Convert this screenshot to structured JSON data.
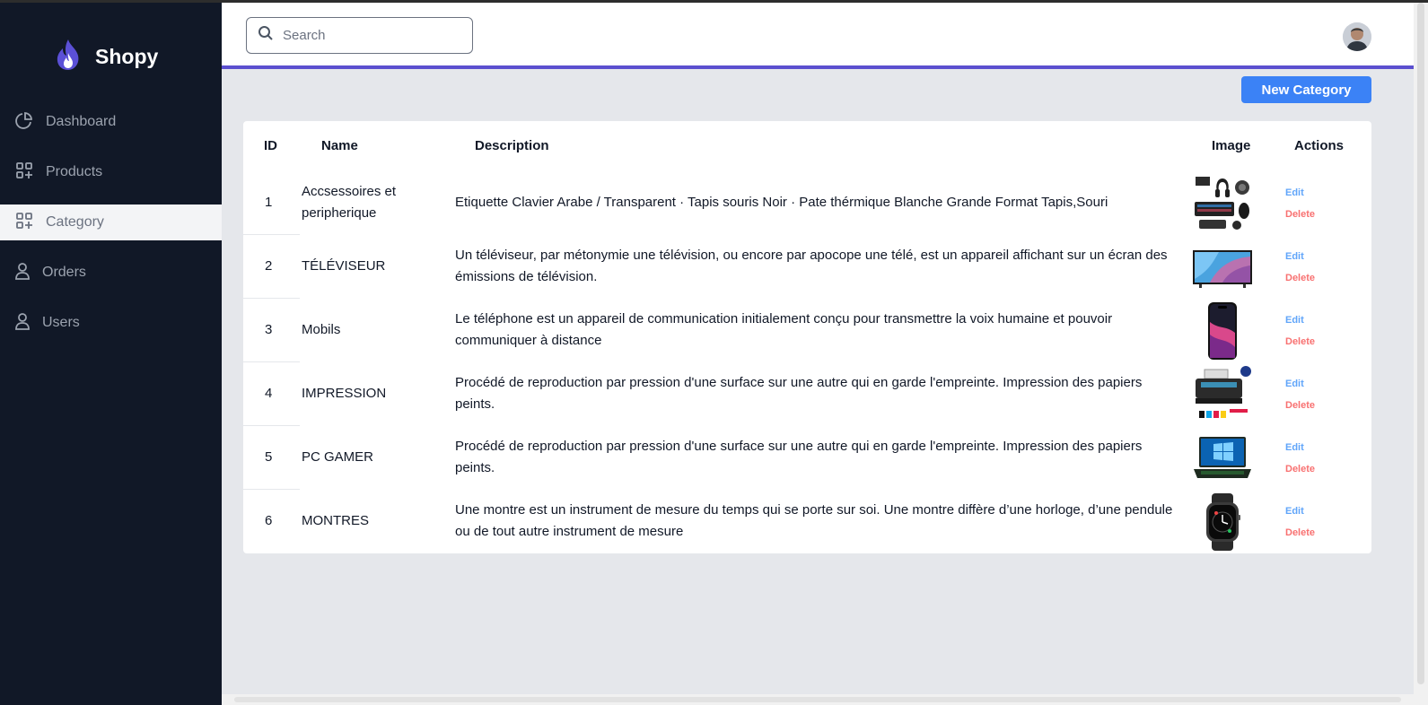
{
  "app": {
    "brand_name": "Shopy",
    "accent_color": "#5b4fcf",
    "button_color": "#3b82f6",
    "sidebar_color": "#111827"
  },
  "sidebar": {
    "items": [
      {
        "label": "Dashboard",
        "icon": "pie-chart-icon",
        "active": false
      },
      {
        "label": "Products",
        "icon": "grid-plus-icon",
        "active": false
      },
      {
        "label": "Category",
        "icon": "grid-plus-icon",
        "active": true
      },
      {
        "label": "Orders",
        "icon": "user-icon",
        "active": false
      },
      {
        "label": "Users",
        "icon": "user-icon",
        "active": false
      }
    ]
  },
  "header": {
    "search_placeholder": "Search",
    "avatar_icon": "user-avatar"
  },
  "toolbar": {
    "new_category_label": "New Category"
  },
  "table": {
    "columns": [
      "ID",
      "Name",
      "Description",
      "Image",
      "Actions"
    ],
    "edit_label": "Edit",
    "delete_label": "Delete",
    "rows": [
      {
        "id": "1",
        "name": "Accsessoires et peripherique",
        "description": "Etiquette Clavier Arabe / Transparent · Tapis souris Noir · Pate thérmique Blanche Grande Format Tapis,Souri",
        "image": "accessories-photo"
      },
      {
        "id": "2",
        "name": "TÉLÉVISEUR",
        "description": "Un téléviseur, par métonymie une télévision, ou encore par apocope une télé, est un appareil affichant sur un écran des émissions de télévision.",
        "image": "tv-photo"
      },
      {
        "id": "3",
        "name": "Mobils",
        "description": "Le téléphone est un appareil de communication initialement conçu pour transmettre la voix humaine et pouvoir communiquer à distance",
        "image": "phone-photo"
      },
      {
        "id": "4",
        "name": "IMPRESSION",
        "description": "Procédé de reproduction par pression d'une surface sur une autre qui en garde l'empreinte. Impression des papiers peints.",
        "image": "printer-photo"
      },
      {
        "id": "5",
        "name": "PC GAMER",
        "description": "Procédé de reproduction par pression d'une surface sur une autre qui en garde l'empreinte. Impression des papiers peints.",
        "image": "laptop-photo"
      },
      {
        "id": "6",
        "name": "MONTRES",
        "description": "Une montre est un instrument de mesure du temps qui se porte sur soi. Une montre diffère d’une horloge, d’une pendule ou de tout autre instrument de mesure",
        "image": "watch-photo"
      }
    ]
  }
}
